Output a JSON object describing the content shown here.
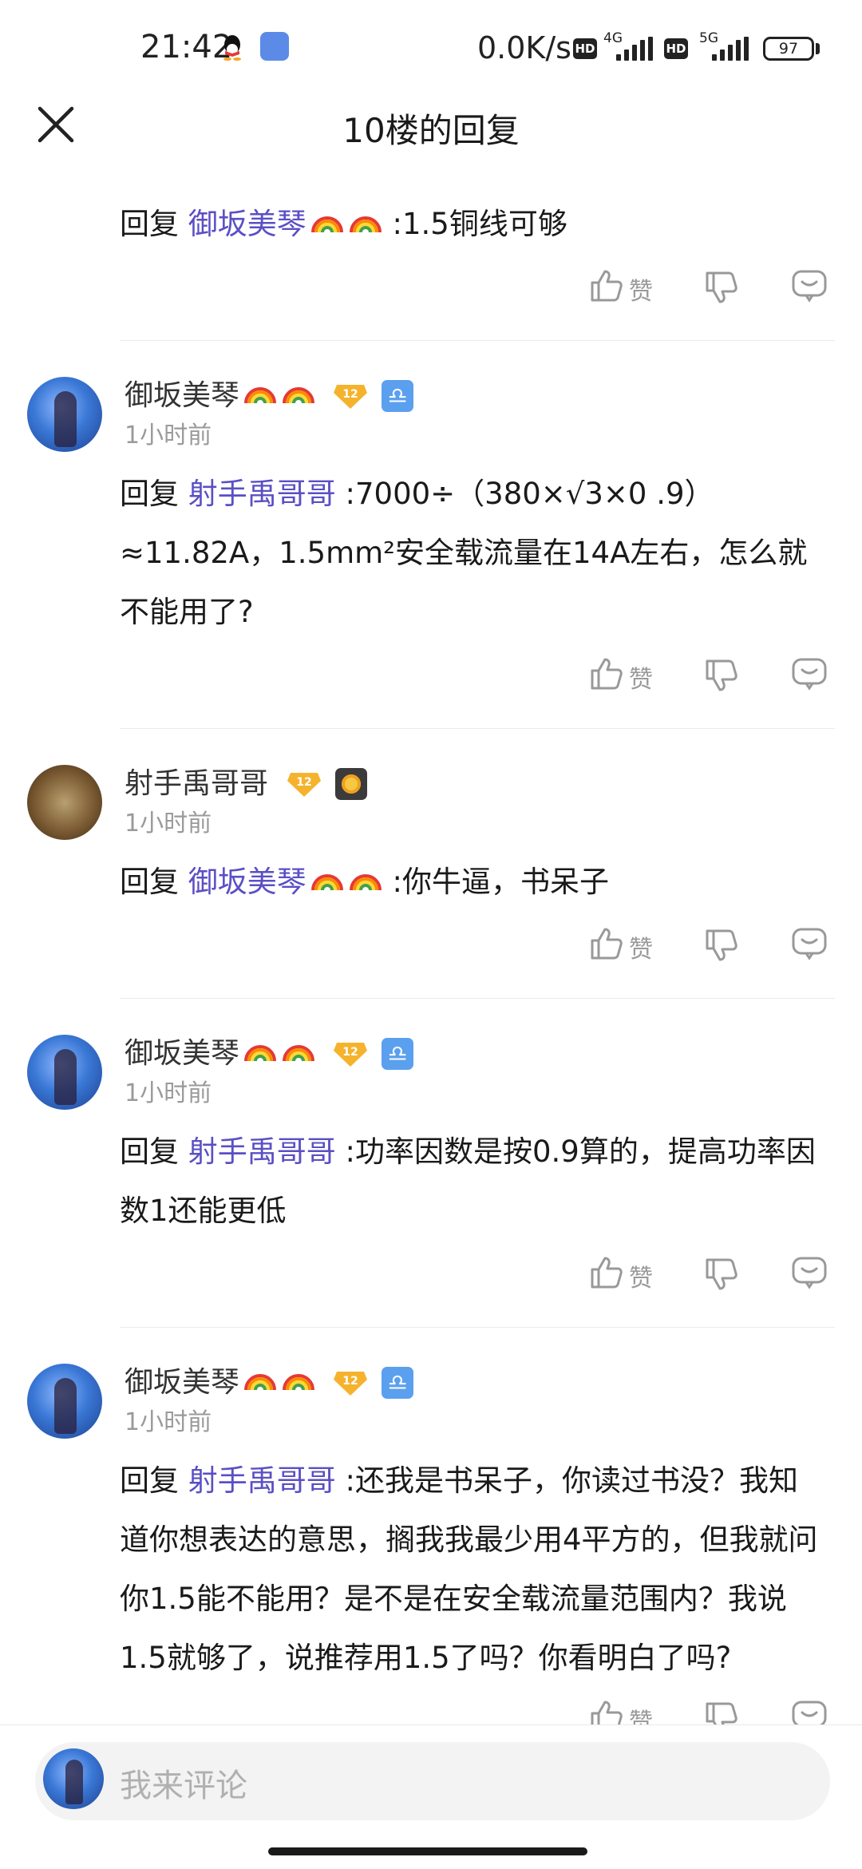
{
  "status_bar": {
    "time": "21:42",
    "net_speed": "0.0K/s",
    "sim1": {
      "hd": "HD",
      "type": "4G"
    },
    "sim2": {
      "hd": "HD",
      "type": "5G"
    },
    "battery": "97"
  },
  "header": {
    "title": "10楼的回复"
  },
  "actions": {
    "like_label": "赞"
  },
  "first_reply": {
    "prefix": "回复 ",
    "mention": "御坂美琴",
    "body": " :1.5铜线可够"
  },
  "comments": [
    {
      "username": "御坂美琴",
      "level": "12",
      "badge": "libra",
      "time": "1小时前",
      "prefix": "回复 ",
      "mention": "射手禹哥哥",
      "body": " :7000÷（380×√3×0 .9）≈11.82A，1.5mm²安全载流量在14A左右，怎么就不能用了?"
    },
    {
      "username": "射手禹哥哥",
      "level": "12",
      "badge": "sun",
      "time": "1小时前",
      "prefix": "回复 ",
      "mention": "御坂美琴",
      "body": " :你牛逼，书呆子"
    },
    {
      "username": "御坂美琴",
      "level": "12",
      "badge": "libra",
      "time": "1小时前",
      "prefix": "回复 ",
      "mention": "射手禹哥哥",
      "body": " :功率因数是按0.9算的，提高功率因数1还能更低"
    },
    {
      "username": "御坂美琴",
      "level": "12",
      "badge": "libra",
      "time": "1小时前",
      "prefix": "回复 ",
      "mention": "射手禹哥哥",
      "body": " :还我是书呆子，你读过书没？我知道你想表达的意思，搁我我最少用4平方的，但我就问你1.5能不能用？是不是在安全载流量范围内？我说1.5就够了，说推荐用1.5了吗？你看明白了吗?"
    }
  ],
  "comment_input": {
    "placeholder": "我来评论"
  },
  "colors": {
    "mention": "#5a4fc4",
    "time": "#9a9a9a",
    "level_badge": "#f5b32d",
    "libra_badge": "#5aa0ee"
  }
}
